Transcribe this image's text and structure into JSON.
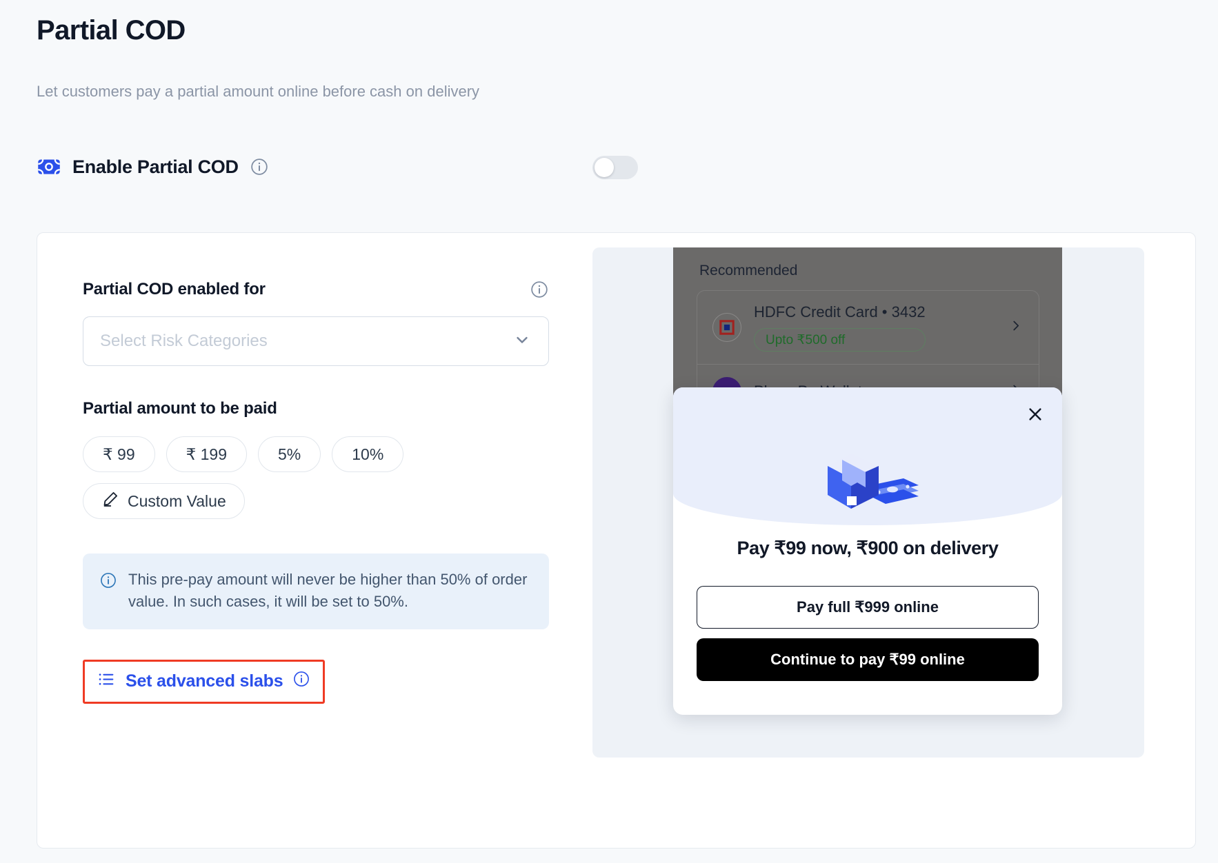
{
  "header": {
    "title": "Partial COD",
    "subtitle": "Let customers pay a partial amount online before cash on delivery"
  },
  "enable": {
    "label": "Enable Partial COD",
    "icon": "cash-note-icon",
    "info_icon": "info-circle-icon",
    "toggle_state": "off"
  },
  "form": {
    "risk": {
      "label": "Partial COD enabled for",
      "info_icon": "info-circle-icon",
      "placeholder": "Select Risk Categories",
      "value": "",
      "chevron_icon": "chevron-down-icon"
    },
    "amount": {
      "label": "Partial amount to be paid",
      "chips": [
        {
          "label": "₹ 99"
        },
        {
          "label": "₹ 199"
        },
        {
          "label": "5%"
        },
        {
          "label": "10%"
        }
      ],
      "custom": {
        "label": "Custom Value",
        "icon": "pencil-edit-icon"
      }
    },
    "note": {
      "icon": "info-circle-icon",
      "text": "This pre-pay amount will never be higher than 50% of order value. In such cases, it will be set to 50%."
    },
    "advanced": {
      "label": "Set advanced slabs",
      "list_icon": "list-bullet-icon",
      "info_icon": "info-circle-icon",
      "highlight_color": "#ef3b24"
    }
  },
  "preview": {
    "checkout": {
      "section_title": "Recommended",
      "methods": [
        {
          "name": "HDFC Credit Card • 3432",
          "offer": "Upto ₹500 off",
          "icon": "hdfc-bank-icon",
          "chevron_icon": "chevron-right-icon"
        },
        {
          "name": "PhonePe Wallet",
          "offer": "",
          "icon": "phonepe-icon",
          "chevron_icon": "chevron-right-icon"
        }
      ]
    },
    "modal": {
      "close_icon": "close-x-icon",
      "illustration": "parcel-with-cash-icon",
      "title": "Pay ₹99 now, ₹900 on delivery",
      "secondary_button": "Pay full ₹999 online",
      "primary_button": "Continue to pay ₹99 online"
    }
  },
  "colors": {
    "accent_blue": "#2b50ea",
    "highlight_red": "#ef3b24",
    "note_bg": "#e9f1fa",
    "primary_button": "#000000"
  }
}
